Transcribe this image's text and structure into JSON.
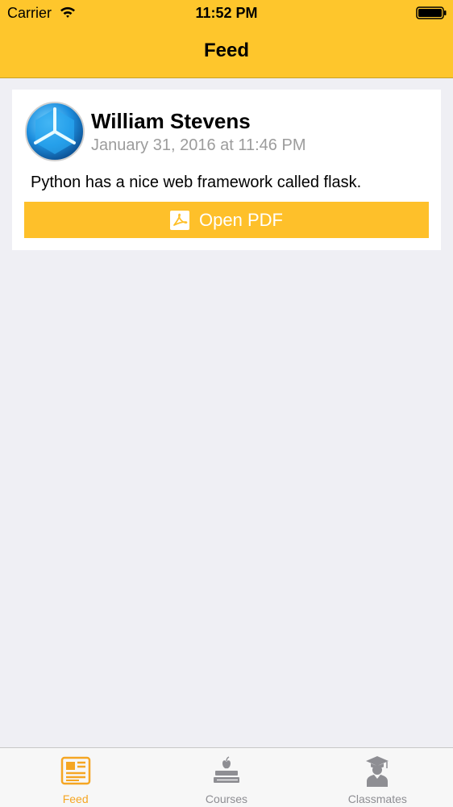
{
  "status_bar": {
    "carrier": "Carrier",
    "time": "11:52 PM"
  },
  "nav": {
    "title": "Feed"
  },
  "feed": [
    {
      "author": "William Stevens",
      "timestamp": "January 31, 2016 at 11:46 PM",
      "body": "Python has a nice web framework called flask.",
      "button_label": "Open PDF",
      "button_icon": "pdf-icon"
    }
  ],
  "tabs": [
    {
      "label": "Feed",
      "icon": "newspaper-icon",
      "active": true
    },
    {
      "label": "Courses",
      "icon": "books-apple-icon",
      "active": false
    },
    {
      "label": "Classmates",
      "icon": "graduate-icon",
      "active": false
    }
  ],
  "colors": {
    "header": "#fec62c",
    "button": "#fec02a",
    "active_tab": "#f5a623",
    "inactive_tab": "#8e8e93",
    "background": "#efeff4"
  }
}
